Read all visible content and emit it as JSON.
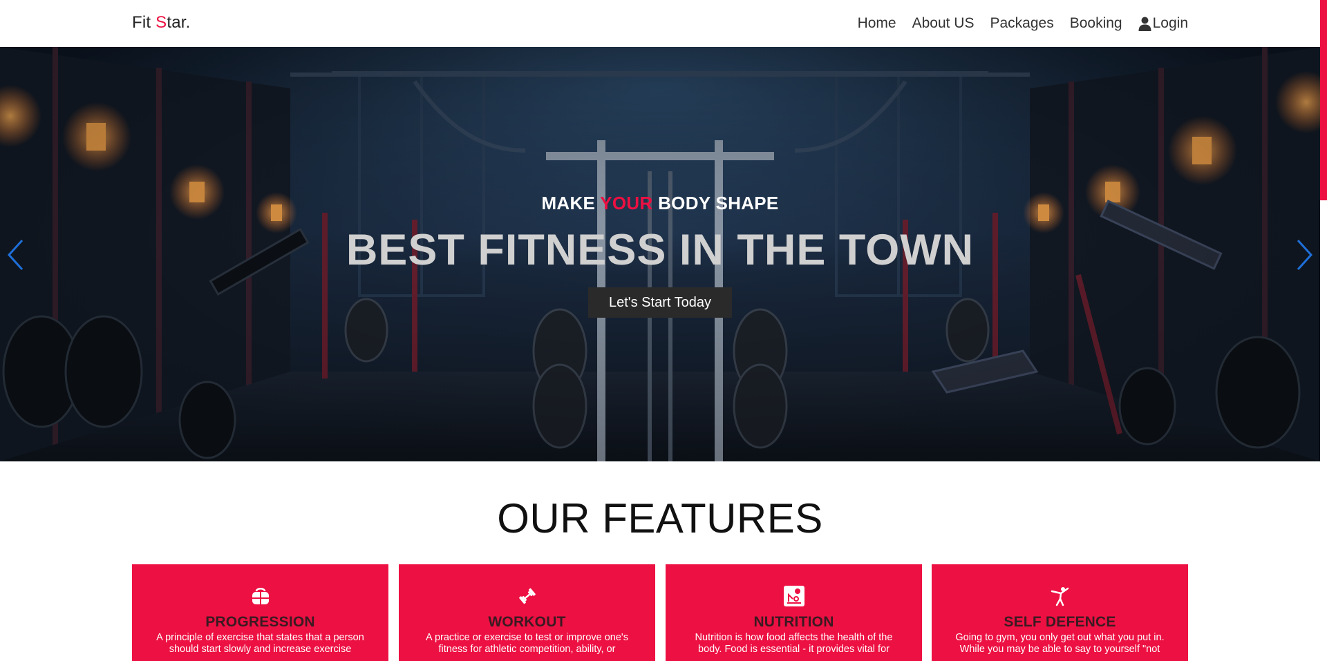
{
  "navbar": {
    "brand_prefix": "Fit ",
    "brand_accent": "S",
    "brand_suffix": "tar.",
    "links": [
      "Home",
      "About US",
      "Packages",
      "Booking",
      "Login"
    ],
    "login_icon": "user-icon"
  },
  "hero": {
    "subtitle_before": "MAKE ",
    "subtitle_accent": "YOUR",
    "subtitle_after": " BODY SHAPE",
    "title": "BEST FITNESS IN THE TOWN",
    "cta_label": "Let's Start Today",
    "prev_icon": "chevron-left-icon",
    "next_icon": "chevron-right-icon"
  },
  "features": {
    "heading": "OUR FEATURES",
    "cards": [
      {
        "icon": "gym-bag-icon",
        "title": "PROGRESSION",
        "desc": "A principle of exercise that states that a person should start slowly and increase exercise"
      },
      {
        "icon": "dumbbell-icon",
        "title": "WORKOUT",
        "desc": "A practice or exercise to test or improve one's fitness for athletic competition, ability, or"
      },
      {
        "icon": "nutrition-scale-icon",
        "title": "NUTRITION",
        "desc": "Nutrition is how food affects the health of the body. Food is essential - it provides vital for"
      },
      {
        "icon": "martial-arts-icon",
        "title": "SELF DEFENCE",
        "desc": "Going to gym, you only get out what you put in. While you may be able to say to yourself \"not"
      }
    ]
  },
  "colors": {
    "accent": "#ed1042",
    "button_bg": "#2a2a2a",
    "carousel_arrow": "#1e6fd9"
  }
}
